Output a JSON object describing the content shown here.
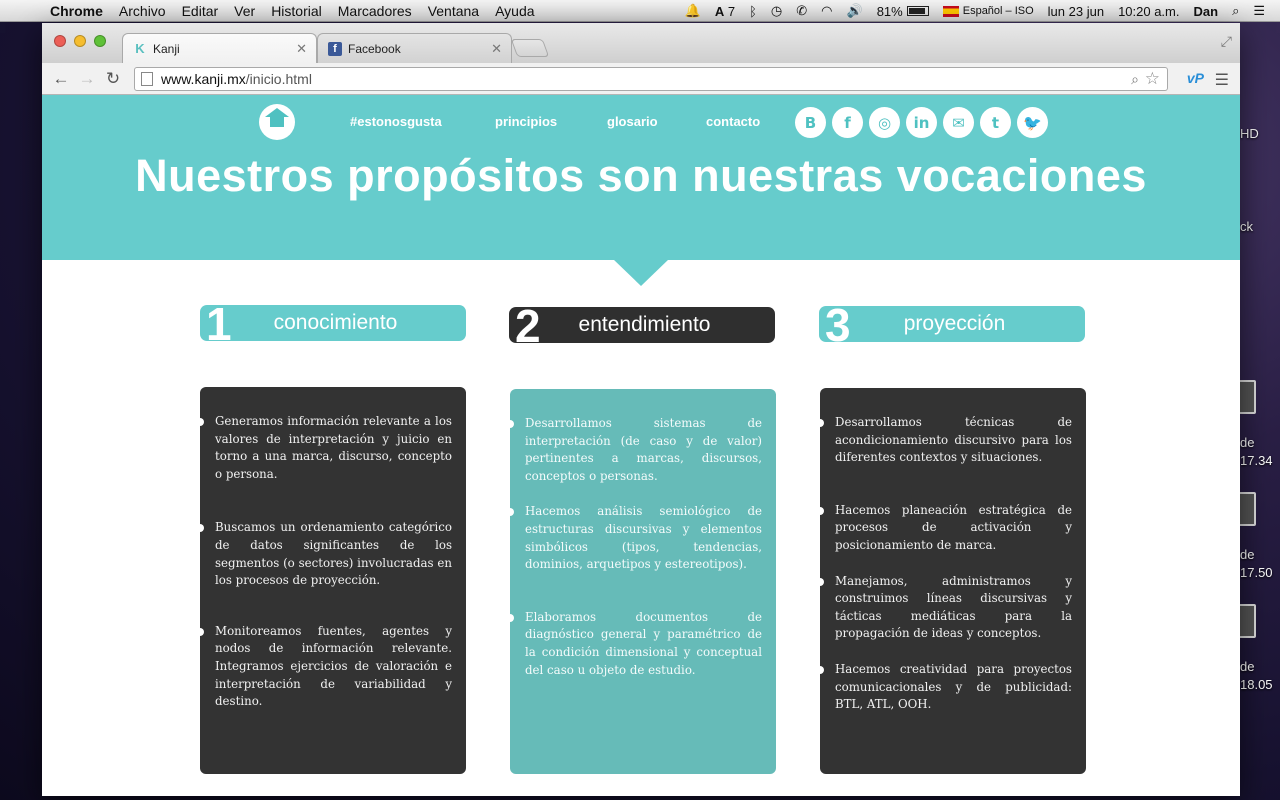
{
  "menubar": {
    "app": "Chrome",
    "items": [
      "Archivo",
      "Editar",
      "Ver",
      "Historial",
      "Marcadores",
      "Ventana",
      "Ayuda"
    ],
    "adobe_count": "7",
    "battery": "81%",
    "input_source": "Español – ISO",
    "date": "lun 23 jun",
    "time": "10:20 a.m.",
    "user": "Dan"
  },
  "desktop": {
    "labels": [
      "HD",
      "ck",
      "de",
      "17.34",
      "de",
      "17.50",
      "de",
      "18.05"
    ]
  },
  "browser": {
    "tabs": [
      {
        "title": "Kanji",
        "favicon": "K"
      },
      {
        "title": "Facebook",
        "favicon": "f"
      }
    ],
    "url_host": "www.kanji.mx",
    "url_path": "/inicio.html"
  },
  "site": {
    "nav": [
      "#estonosgusta",
      "principios",
      "glosario",
      "contacto"
    ],
    "social": [
      "blogger-icon",
      "facebook-icon",
      "instagram-icon",
      "linkedin-icon",
      "mail-icon",
      "tumblr-icon",
      "twitter-icon"
    ],
    "social_glyphs": [
      "B",
      "f",
      "◎",
      "in",
      "✉",
      "t",
      "🐦"
    ],
    "title": "Nuestros propósitos son nuestras vocaciones",
    "columns": [
      {
        "number": "1",
        "heading": "conocimiento",
        "items": [
          "Generamos información relevante a los valores de interpretación y juicio en torno a una marca, discurso, concepto o persona.",
          "Buscamos un ordenamiento categórico de datos significantes de los segmentos (o sectores) involucradas en los procesos de proyección.",
          "Monitoreamos fuentes, agentes y nodos de información relevante. Integramos ejercicios de valoración e interpretación de variabilidad y destino."
        ]
      },
      {
        "number": "2",
        "heading": "entendimiento",
        "items": [
          "Desarrollamos sistemas de interpretación (de caso y de valor) pertinentes a marcas, discursos, conceptos o personas.",
          "Hacemos análisis semiológico de estructuras discursivas y elementos simbólicos (tipos, tendencias, dominios, arquetipos y estereotipos).",
          "Elaboramos documentos de diagnóstico general y paramétrico de la condición dimensional y conceptual del caso u objeto de estudio."
        ]
      },
      {
        "number": "3",
        "heading": "proyección",
        "items": [
          "Desarrollamos técnicas de acondicionamiento discursivo para los diferentes contextos y situaciones.",
          "Hacemos planeación estratégica de procesos de activación y posicionamiento de marca.",
          "Manejamos, administramos y construimos líneas discursivas y tácticas mediáticas para la propagación de ideas y conceptos.",
          "Hacemos creatividad para proyectos comunicacionales y de publicidad: BTL, ATL, OOH."
        ]
      }
    ]
  },
  "colors": {
    "teal": "#66cccc",
    "card_teal": "#66bbb8",
    "dark": "#333333"
  }
}
